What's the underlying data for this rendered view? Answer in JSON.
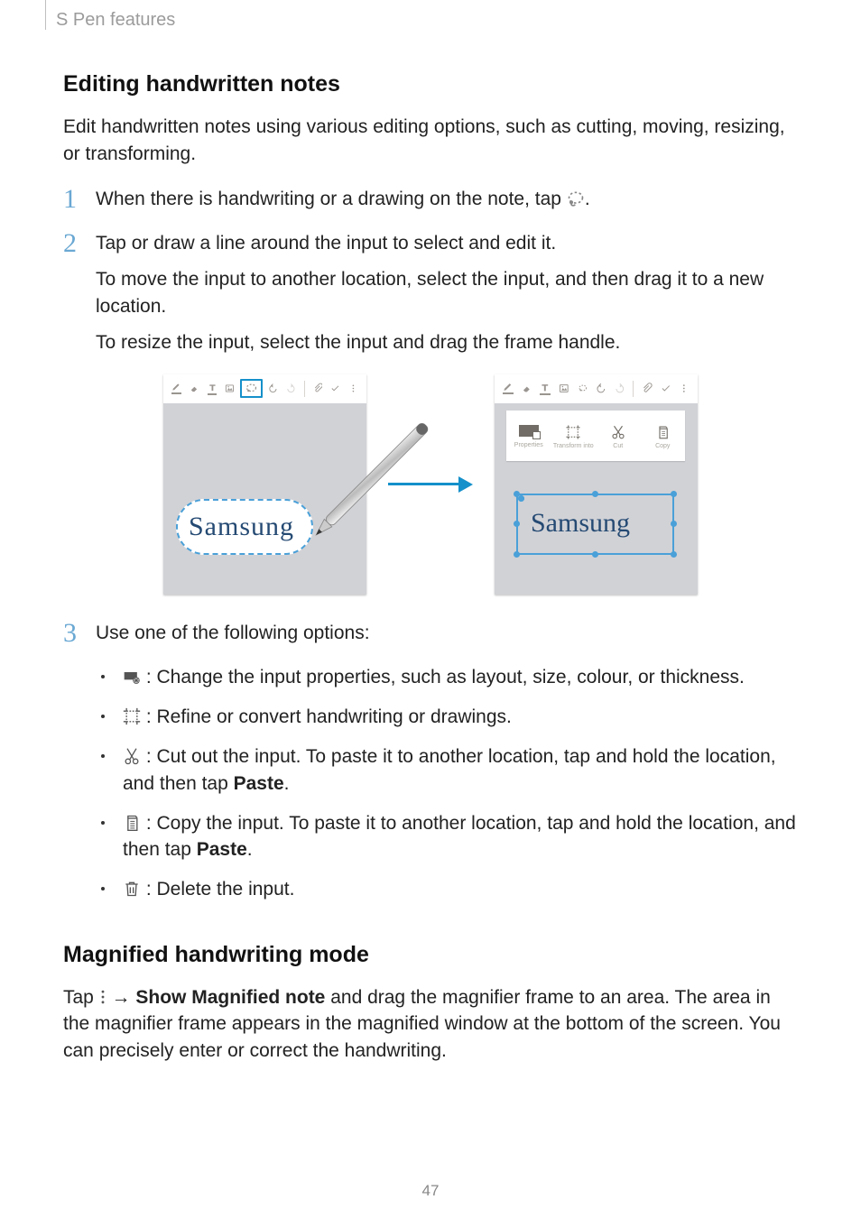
{
  "header": {
    "breadcrumb": "S Pen features"
  },
  "sections": {
    "edit": {
      "title": "Editing handwritten notes",
      "intro": "Edit handwritten notes using various editing options, such as cutting, moving, resizing, or transforming.",
      "step1_a": "When there is handwriting or a drawing on the note, tap ",
      "step1_b": ".",
      "step2_a": "Tap or draw a line around the input to select and edit it.",
      "step2_b": "To move the input to another location, select the input, and then drag it to a new location.",
      "step2_c": "To resize the input, select the input and drag the frame handle.",
      "step3_a": "Use one of the following options:",
      "bullets": {
        "props": " : Change the input properties, such as layout, size, colour, or thickness.",
        "refine": " : Refine or convert handwriting or drawings.",
        "cut_a": " : Cut out the input. To paste it to another location, tap and hold the location, and then tap ",
        "cut_paste": "Paste",
        "cut_b": ".",
        "copy_a": " : Copy the input. To paste it to another location, tap and hold the location, and then tap ",
        "copy_paste": "Paste",
        "copy_b": ".",
        "delete": " : Delete the input."
      }
    },
    "magnify": {
      "title": "Magnified handwriting mode",
      "a": "Tap ",
      "b": " → ",
      "menu": "Show Magnified note",
      "c": " and drag the magnifier frame to an area. The area in the magnifier frame appears in the magnified window at the bottom of the screen. You can precisely enter or correct the handwriting."
    }
  },
  "mock": {
    "hw_text": "Samsung",
    "ctx": {
      "props": "Properties",
      "transform": "Transform into",
      "cut": "Cut",
      "copy": "Copy"
    }
  },
  "page": "47"
}
